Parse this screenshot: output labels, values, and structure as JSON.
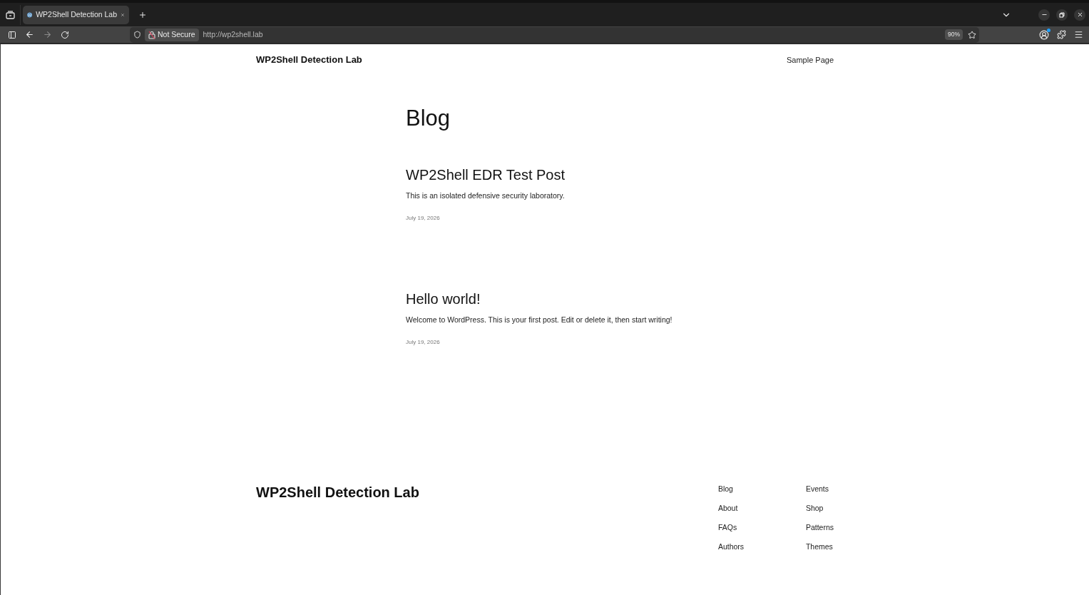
{
  "browser": {
    "tabs": [
      {
        "title": "WP2Shell Detection Lab",
        "selected": true
      }
    ],
    "forward_enabled": false,
    "address_bar": {
      "security_label": "Not Secure",
      "url": "http://wp2shell.lab",
      "zoom": "90%"
    }
  },
  "site_header": {
    "title": "WP2Shell Detection Lab",
    "nav": [
      "Sample Page"
    ]
  },
  "page": {
    "title": "Blog",
    "posts": [
      {
        "title": "WP2Shell EDR Test Post",
        "excerpt": "This is an isolated defensive security laboratory.",
        "date": "July 19, 2026"
      },
      {
        "title": "Hello world!",
        "excerpt": "Welcome to WordPress. This is your first post. Edit or delete it, then start writing!",
        "date": "July 19, 2026"
      }
    ]
  },
  "footer": {
    "title": "WP2Shell Detection Lab",
    "nav_columns": [
      [
        "Blog",
        "About",
        "FAQs",
        "Authors"
      ],
      [
        "Events",
        "Shop",
        "Patterns",
        "Themes"
      ]
    ]
  }
}
